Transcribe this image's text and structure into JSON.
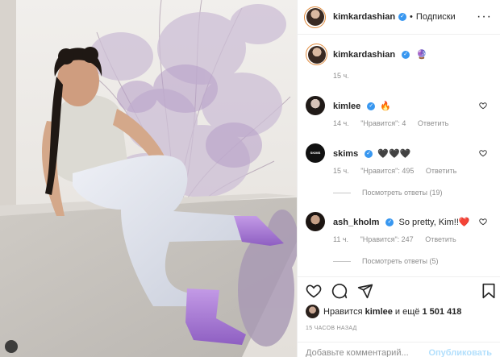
{
  "post": {
    "author": "kimkardashian",
    "header_separator": "•",
    "follow_label": "Подписки",
    "more_label": "···"
  },
  "photo_alt": "",
  "comments": [
    {
      "user": "kimkardashian",
      "text": "",
      "emoji": "🔮",
      "time": "15 ч.",
      "likes": "",
      "reply": "",
      "avatar_kind": "ring"
    },
    {
      "user": "kimlee",
      "text": "🔥",
      "time": "14 ч.",
      "likes": "\"Нравится\": 4",
      "reply": "Ответить",
      "avatar_kind": "dark"
    },
    {
      "user": "skims",
      "text": "🖤🖤🖤",
      "time": "15 ч.",
      "likes": "\"Нравится\": 495",
      "reply": "Ответить",
      "avatar_kind": "skims",
      "replies": "Посмотреть ответы (19)"
    },
    {
      "user": "ash_kholm",
      "text": "So pretty, Kim!!❤️",
      "time": "11 ч.",
      "likes": "\"Нравится\": 247",
      "reply": "Ответить",
      "avatar_kind": "dark",
      "replies": "Посмотреть ответы (5)"
    }
  ],
  "skims_logo_text": "SKIMS",
  "likes": {
    "prefix": "Нравится",
    "user": "kimlee",
    "suffix_prefix": "и ещё",
    "count": "1 501 418"
  },
  "timestamp": "15 ЧАСОВ НАЗАД",
  "comment_input": {
    "placeholder": "Добавьте комментарий...",
    "publish_label": "Опубликовать"
  },
  "icons": [
    "heart-icon",
    "comment-icon",
    "share-icon",
    "bookmark-icon",
    "more-icon",
    "verified-icon",
    "like-small-icon"
  ],
  "colors": {
    "verified": "#3897f0",
    "meta": "#8e8e8e",
    "publish_disabled": "#b2dffc",
    "avatar_ring": "#e08a3c"
  }
}
